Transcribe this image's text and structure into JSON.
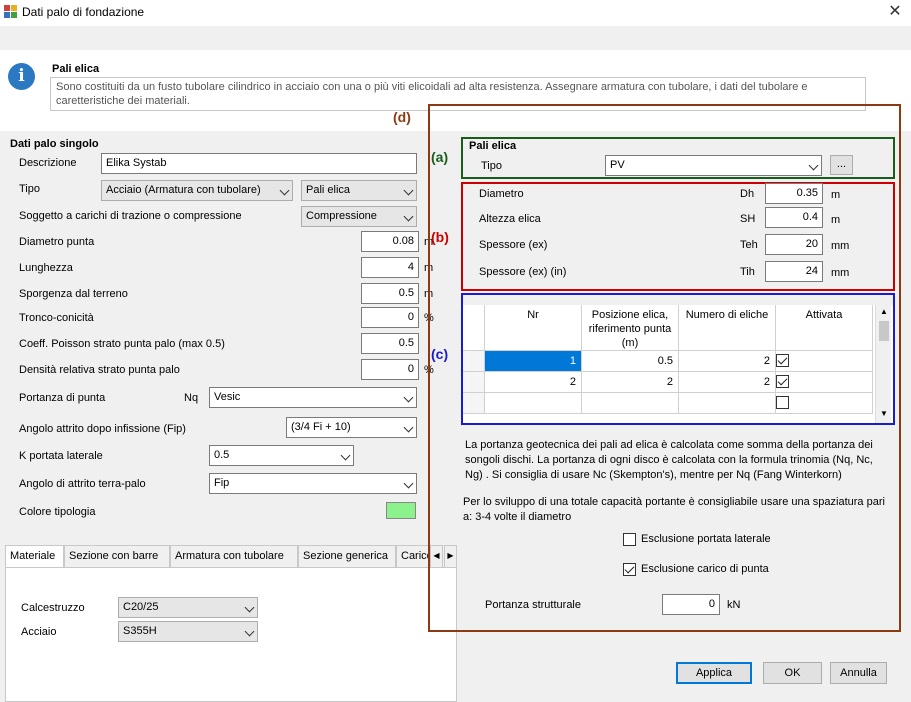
{
  "window": {
    "title": "Dati palo di fondazione"
  },
  "info": {
    "title": "Pali elica",
    "text": "Sono  costituiti da un fusto tubolare cilindrico in acciaio con una o più viti elicoidali ad alta resistenza.  Assegnare armatura con tubolare, i dati del tubolare e caretteristiche dei materiali."
  },
  "left": {
    "section_title": "Dati palo singolo",
    "descrizione_label": "Descrizione",
    "descrizione_value": "Elika Systab",
    "tipo_label": "Tipo",
    "tipo_value1": "Acciaio (Armatura con tubolare)",
    "tipo_value2": "Pali elica",
    "soggetto_label": "Soggetto a carichi di trazione o compressione",
    "soggetto_value": "Compressione",
    "diametro_label": "Diametro punta",
    "diametro_value": "0.08",
    "diametro_unit": "m",
    "lunghezza_label": "Lunghezza",
    "lunghezza_value": "4",
    "lunghezza_unit": "m",
    "sporgenza_label": "Sporgenza dal terreno",
    "sporgenza_value": "0.5",
    "sporgenza_unit": "m",
    "tronco_label": "Tronco-conicità",
    "tronco_value": "0",
    "tronco_unit": "%",
    "poisson_label": "Coeff. Poisson strato punta palo (max 0.5)",
    "poisson_value": "0.5",
    "densita_label": "Densità relativa strato punta palo",
    "densita_value": "0",
    "densita_unit": "%",
    "portanza_label": "Portanza di punta",
    "portanza_nq": "Nq",
    "portanza_value": "Vesic",
    "angolo_fip_label": "Angolo attrito dopo infissione (Fip)",
    "angolo_fip_value": "(3/4 Fi + 10)",
    "kportata_label": "K portata laterale",
    "kportata_value": "0.5",
    "angolo_terra_label": "Angolo di attrito terra-palo",
    "angolo_terra_value": "Fip",
    "colore_label": "Colore tipologia"
  },
  "tabs": [
    "Materiale",
    "Sezione con barre",
    "Armatura con tubolare",
    "Sezione generica",
    "Carico"
  ],
  "materiale": {
    "cls_label": "Calcestruzzo",
    "cls_value": "C20/25",
    "acciaio_label": "Acciaio",
    "acciaio_value": "S355H"
  },
  "right": {
    "mark_a": "(a)",
    "mark_b": "(b)",
    "mark_c": "(c)",
    "mark_d": "(d)",
    "group_title": "Pali elica",
    "tipo_label": "Tipo",
    "tipo_value": "PV",
    "browse_label": "...",
    "diametro_label": "Diametro",
    "diametro_sym": "Dh",
    "diametro_value": "0.35",
    "diametro_unit": "m",
    "altezza_label": "Altezza elica",
    "altezza_sym": "SH",
    "altezza_value": "0.4",
    "altezza_unit": "m",
    "spessore_label": "Spessore (ex)",
    "spessore_sym": "Teh",
    "spessore_value": "20",
    "spessore_unit": "mm",
    "spessore_in_label": "Spessore (ex) (in)",
    "spessore_in_sym": "Tih",
    "spessore_in_value": "24",
    "spessore_in_unit": "mm",
    "grid": {
      "headers": [
        "Nr",
        "Posizione elica, riferimento punta (m)",
        "Numero di eliche",
        "Attivata"
      ],
      "rows": [
        {
          "nr": "1",
          "pos": "0.5",
          "num": "2"
        },
        {
          "nr": "2",
          "pos": "2",
          "num": "2"
        }
      ]
    },
    "note1": "La portanza geotecnica dei pali ad elica è calcolata come somma della portanza dei songoli dischi. La portanza di ogni disco è calcolata con la formula trinomia (Nq, Nc, Ng) .  Si consiglia di usare Nc (Skempton's), mentre per Nq (Fang  Winterkorn)",
    "note2": "Per lo sviluppo di una totale capacità portante è consigliabile usare una spaziatura pari a: 3-4 volte il diametro",
    "escl_laterale": "Esclusione portata laterale",
    "escl_punta": "Esclusione carico di punta",
    "portanza_label": "Portanza strutturale",
    "portanza_value": "0",
    "portanza_unit": "kN"
  },
  "buttons": {
    "applica": "Applica",
    "ok": "OK",
    "annulla": "Annulla"
  },
  "colors": {
    "color_swatch": "#8cf28c",
    "mark_a": "#1a5c1a",
    "mark_b": "#cc0000",
    "mark_c": "#1a1ad0",
    "mark_d": "#8b3a12"
  }
}
